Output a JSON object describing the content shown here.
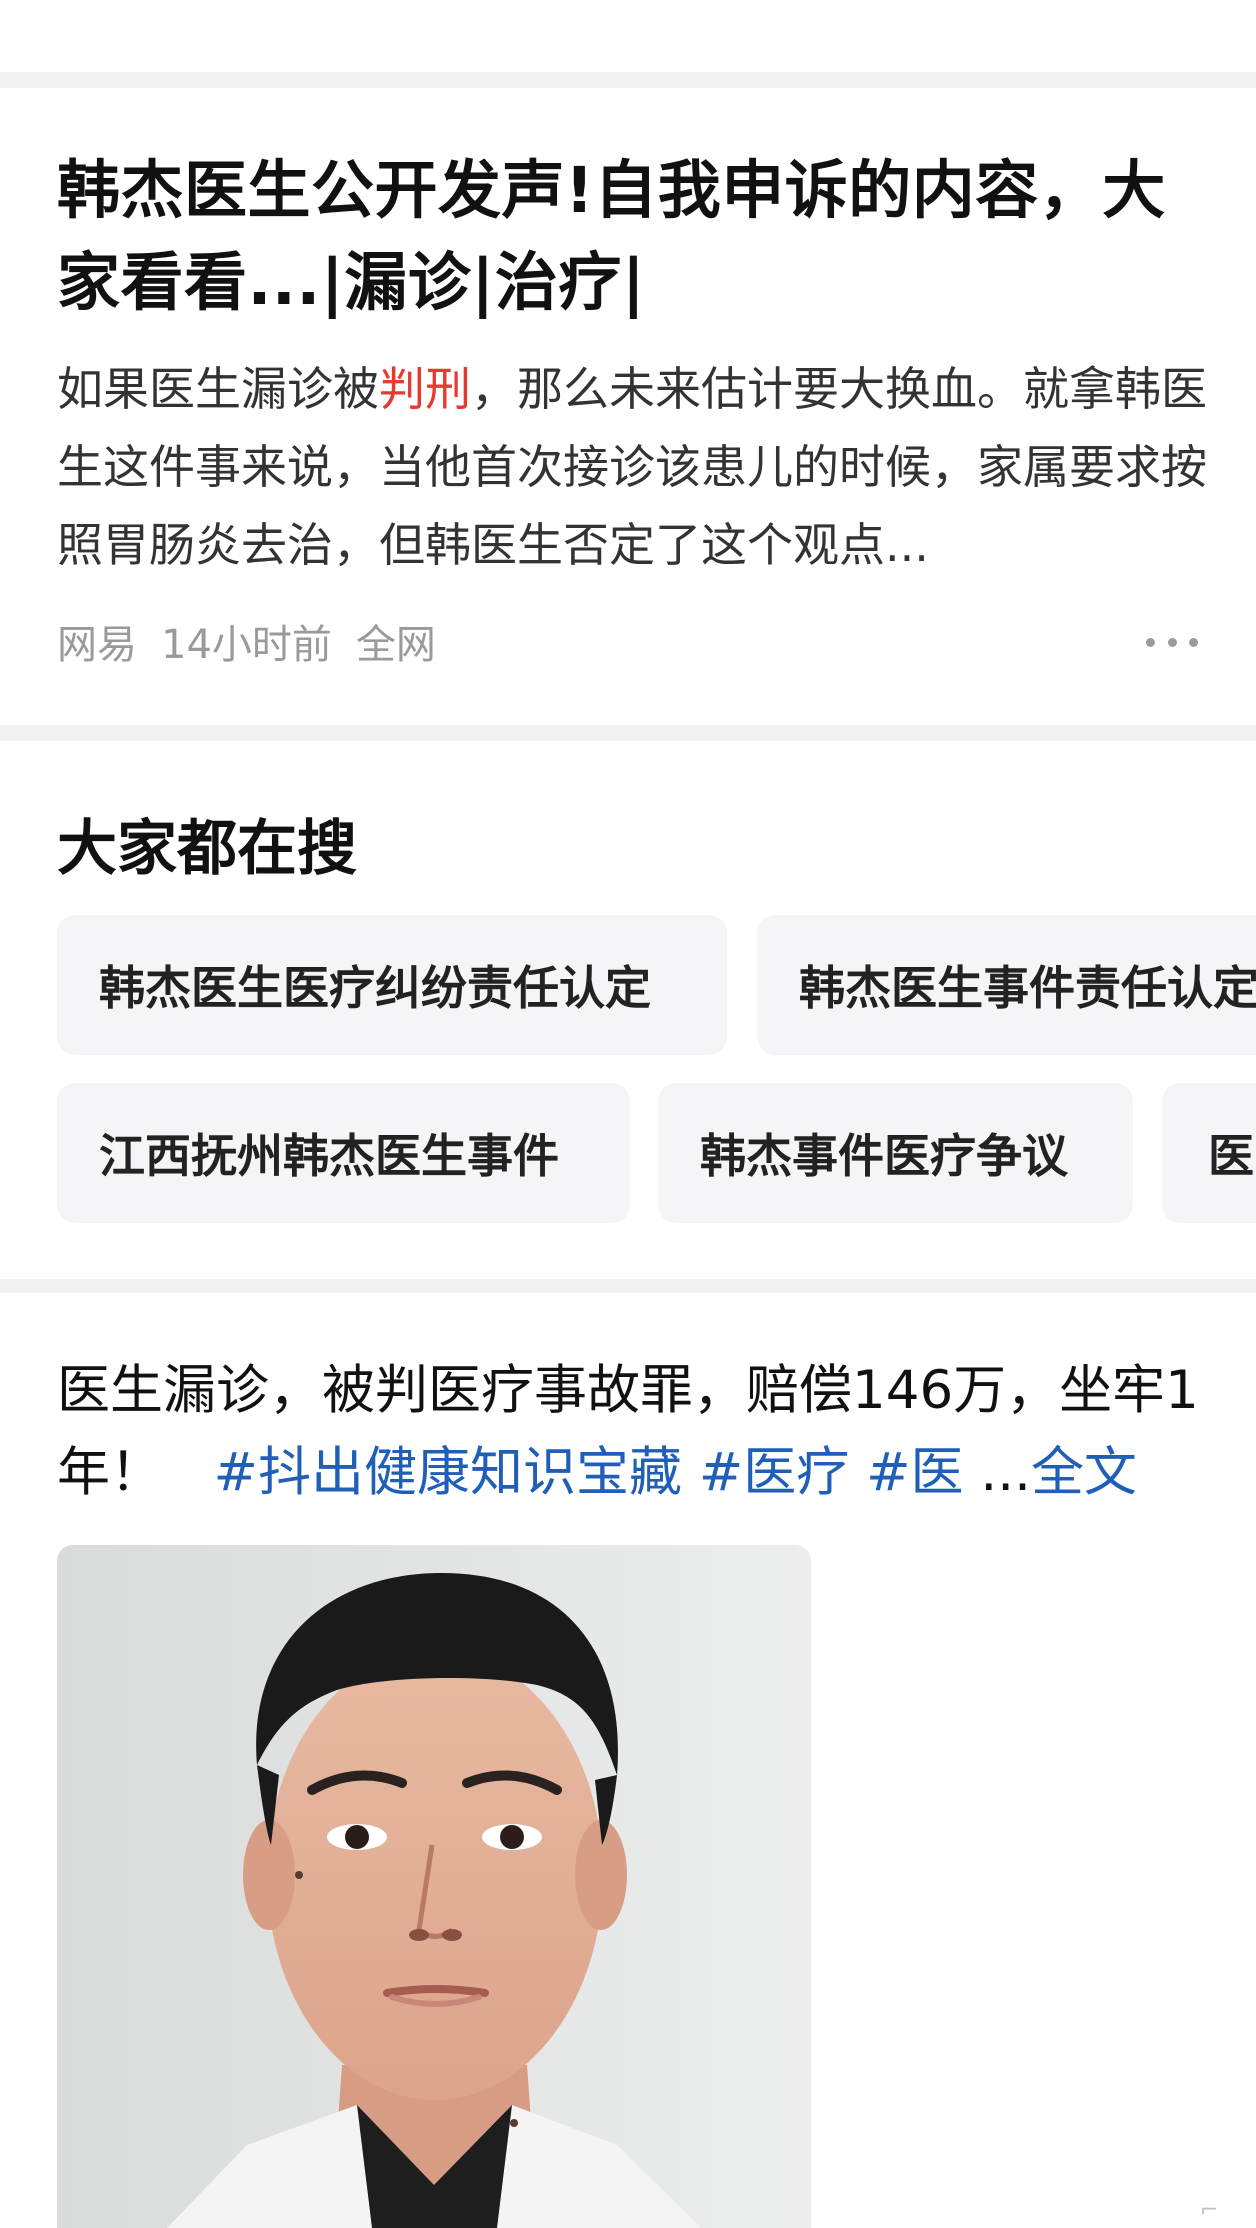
{
  "article": {
    "title": "韩杰医生公开发声!自我申诉的内容，大家看看...|漏诊|治疗|",
    "summary_before": "如果医生漏诊被",
    "summary_highlight": "判刑",
    "summary_after": "，那么未来估计要大换血。就拿韩医生这件事来说，当他首次接诊该患儿的时候，家属要求按照胃肠炎去治，但韩医生否定了这个观点...",
    "source": "网易",
    "time": "14小时前",
    "scope": "全网"
  },
  "related_search": {
    "title": "大家都在搜",
    "chips": [
      "韩杰医生医疗纠纷责任认定",
      "韩杰医生事件责任认定",
      "江西抚州韩杰医生事件",
      "韩杰事件医疗争议",
      "医"
    ]
  },
  "post": {
    "text": "医生漏诊，被判医疗事故罪，赔偿146万，坐牢1年！",
    "tags": [
      "#抖出健康知识宝藏",
      "#医疗",
      "#医"
    ],
    "ellipsis": "...",
    "full_text_link": "全文"
  },
  "colors": {
    "highlight": "#e8392f",
    "link": "#1f5fb8",
    "divider": "#f2f2f4",
    "chip_bg": "#f5f5f7"
  }
}
